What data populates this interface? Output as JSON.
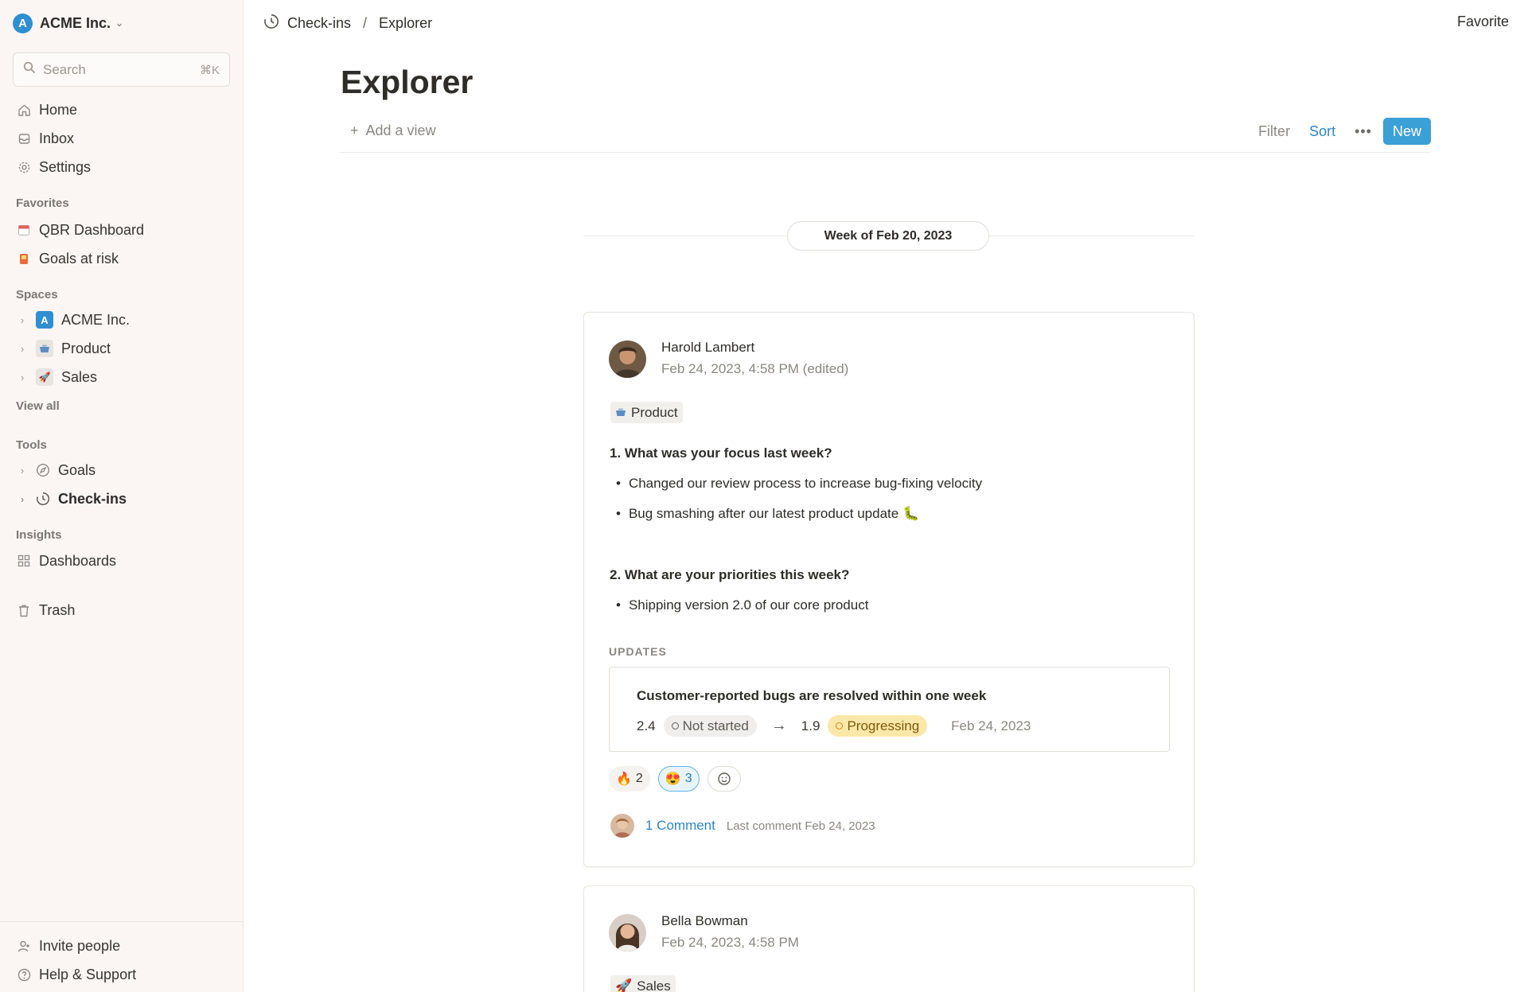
{
  "sidebar": {
    "workspace": "ACME Inc.",
    "search": {
      "placeholder": "Search",
      "shortcut": "⌘K"
    },
    "nav": [
      {
        "label": "Home",
        "icon": "home-icon"
      },
      {
        "label": "Inbox",
        "icon": "inbox-icon"
      },
      {
        "label": "Settings",
        "icon": "gear-icon"
      }
    ],
    "favorites_title": "Favorites",
    "favorites": [
      {
        "label": "QBR Dashboard",
        "icon": "calendar-icon"
      },
      {
        "label": "Goals at risk",
        "icon": "alert-icon"
      }
    ],
    "spaces_title": "Spaces",
    "spaces": [
      {
        "label": "ACME Inc.",
        "icon": "acme-logo-icon"
      },
      {
        "label": "Product",
        "icon": "pot-icon"
      },
      {
        "label": "Sales",
        "icon": "rocket-icon"
      }
    ],
    "view_all": "View all",
    "tools_title": "Tools",
    "tools": [
      {
        "label": "Goals",
        "icon": "compass-icon"
      },
      {
        "label": "Check-ins",
        "icon": "clock-icon"
      }
    ],
    "insights_title": "Insights",
    "insights": [
      {
        "label": "Dashboards",
        "icon": "grid-icon"
      }
    ],
    "trash": "Trash",
    "invite": "Invite people",
    "help": "Help & Support"
  },
  "topbar": {
    "breadcrumb": [
      "Check-ins",
      "Explorer"
    ],
    "favorite": "Favorite"
  },
  "page": {
    "title": "Explorer",
    "add_view": "Add a view",
    "filter": "Filter",
    "sort": "Sort",
    "new": "New",
    "week": "Week of Feb 20, 2023"
  },
  "checkins": [
    {
      "author": "Harold Lambert",
      "date": "Feb 24, 2023, 4:58 PM (edited)",
      "tag": "Product",
      "q1": "1. What was your focus last week?",
      "q1_bullets": [
        "Changed our review process to increase bug-fixing velocity",
        "Bug smashing after our latest product update 🐛"
      ],
      "q2": "2. What are your priorities this week?",
      "q2_bullets": [
        "Shipping version 2.0 of our core product"
      ],
      "updates_label": "UPDATES",
      "update": {
        "title": "Customer-reported bugs are resolved within one week",
        "from_value": "2.4",
        "from_status": "Not started",
        "to_value": "1.9",
        "to_status": "Progressing",
        "date": "Feb 24, 2023"
      },
      "reactions": [
        {
          "emoji": "🔥",
          "count": "2",
          "active": false
        },
        {
          "emoji": "😍",
          "count": "3",
          "active": true
        }
      ],
      "comments": {
        "link": "1 Comment",
        "meta": "Last comment Feb 24, 2023"
      }
    },
    {
      "author": "Bella Bowman",
      "date": "Feb 24, 2023, 4:58 PM",
      "tag": "Sales"
    }
  ],
  "colors": {
    "accent": "#3aa0d5",
    "link": "#2b86c5",
    "progressing": "#fbe7a8",
    "sidebar_bg": "#fbf6f3"
  }
}
